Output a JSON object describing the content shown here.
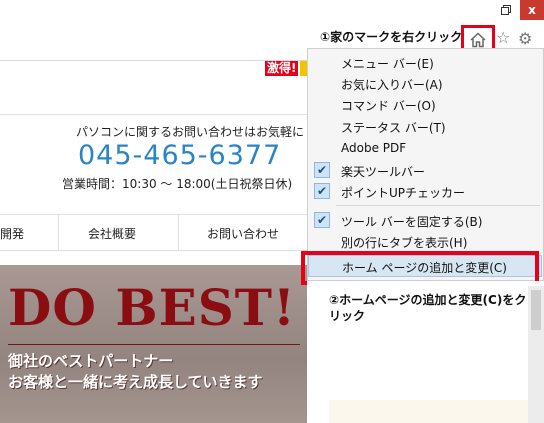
{
  "window": {
    "maximize_icon": "restore-icon",
    "close_label": "x"
  },
  "toolbar": {
    "instruction": "①家のマークを右クリック",
    "icons": [
      "home-icon",
      "star-icon",
      "gear-icon"
    ]
  },
  "site": {
    "badge": "激得!",
    "contact_text": "パソコンに関するお問い合わせはお気軽に",
    "phone": "045-465-6377",
    "hours": "営業時間：10:30 〜 18:00(土日祝祭日休)",
    "nav": [
      "開発",
      "会社概要",
      "お問い合わせ"
    ],
    "hero_title": "DO BEST!",
    "hero_sub1": "御社のベストパートナー",
    "hero_sub2": "お客様と一緒に考え成長していきます"
  },
  "menu": {
    "items": [
      {
        "label": "メニュー バー(E)",
        "checked": false
      },
      {
        "label": "お気に入りバー(A)",
        "checked": false
      },
      {
        "label": "コマンド バー(O)",
        "checked": false
      },
      {
        "label": "ステータス バー(T)",
        "checked": false
      },
      {
        "label": "Adobe PDF",
        "checked": false
      },
      {
        "label": "楽天ツールバー",
        "checked": true
      },
      {
        "label": "ポイントUPチェッカー",
        "checked": true
      },
      {
        "label": "ツール バーを固定する(B)",
        "checked": true
      },
      {
        "label": "別の行にタブを表示(H)",
        "checked": false
      },
      {
        "label": "ホーム ページの追加と変更(C)",
        "checked": false
      }
    ],
    "check_glyph": "✔"
  },
  "instruction2": "②ホームページの追加と変更(C)をクリック",
  "colors": {
    "highlight": "#e6001a",
    "phone": "#2b84c5",
    "hero_text": "#8a0d12"
  }
}
